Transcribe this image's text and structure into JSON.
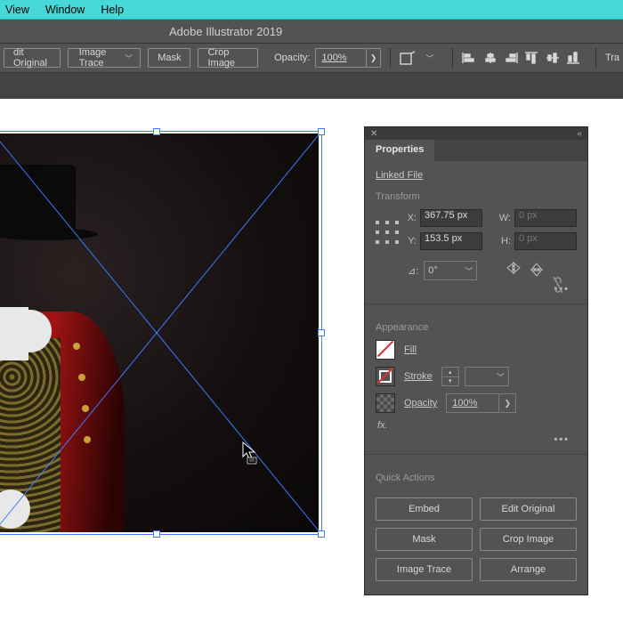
{
  "menu": {
    "items": [
      "View",
      "Window",
      "Help"
    ]
  },
  "app_title": "Adobe Illustrator 2019",
  "control_bar": {
    "edit_original": "dit Original",
    "image_trace": "Image Trace",
    "mask": "Mask",
    "crop": "Crop Image",
    "opacity_label": "Opacity:",
    "opacity_value": "100%",
    "transform_cut": "Tra"
  },
  "panel": {
    "tab": "Properties",
    "linked_file": "Linked File",
    "transform": {
      "heading": "Transform",
      "x_label": "X:",
      "x_value": "367.75 px",
      "y_label": "Y:",
      "y_value": "153.5 px",
      "w_label": "W:",
      "w_value": "0 px",
      "h_label": "H:",
      "h_value": "0 px",
      "angle_label": "⊿:",
      "angle_value": "0°"
    },
    "appearance": {
      "heading": "Appearance",
      "fill": "Fill",
      "stroke": "Stroke",
      "opacity_label": "Opacity",
      "opacity_value": "100%",
      "fx": "fx."
    },
    "quick": {
      "heading": "Quick Actions",
      "embed": "Embed",
      "edit_original": "Edit Original",
      "mask": "Mask",
      "crop": "Crop Image",
      "trace": "Image Trace",
      "arrange": "Arrange"
    }
  }
}
